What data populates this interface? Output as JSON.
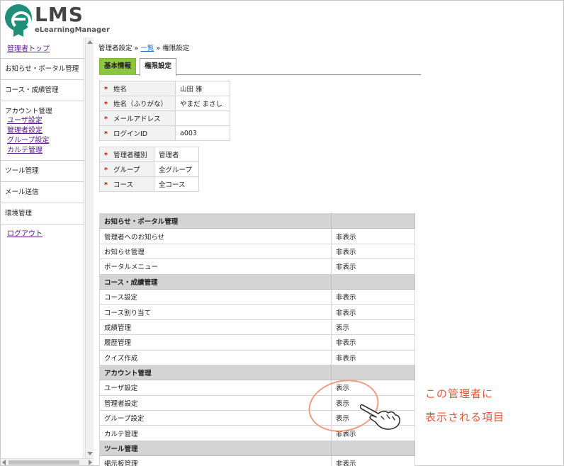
{
  "header": {
    "logo_text": "LMS",
    "logo_subtext": "eLearningManager"
  },
  "sidebar": {
    "admin_top": "管理者トップ",
    "news_portal": "お知らせ・ポータル管理",
    "course_grades": "コース・成績管理",
    "account_title": "アカウント管理",
    "account_links": [
      "ユーザ設定",
      "管理者設定",
      "グループ設定",
      "カルテ管理"
    ],
    "tools": "ツール管理",
    "mail": "メール送信",
    "environment": "環境管理",
    "logout": "ログアウト"
  },
  "breadcrumb": {
    "part1": "管理者設定 » ",
    "link": "一覧",
    "part2": " » 権限設定"
  },
  "tabs": {
    "basic": "基本情報",
    "permission": "権限設定"
  },
  "required_mark": "*",
  "profile": [
    {
      "label": "姓名",
      "value": "山田 雅"
    },
    {
      "label": "姓名（ふりがな）",
      "value": "やまだ まさし"
    },
    {
      "label": "メールアドレス",
      "value": ""
    },
    {
      "label": "ログインID",
      "value": "a003"
    }
  ],
  "roles": [
    {
      "label": "管理者種別",
      "value": "管理者"
    },
    {
      "label": "グループ",
      "value": "全グループ"
    },
    {
      "label": "コース",
      "value": "全コース"
    }
  ],
  "permissions": {
    "groups": [
      {
        "title": "お知らせ・ポータル管理",
        "rows": [
          {
            "name": "管理者へのお知らせ",
            "value": "非表示"
          },
          {
            "name": "お知らせ管理",
            "value": "非表示"
          },
          {
            "name": "ポータルメニュー",
            "value": "非表示"
          }
        ]
      },
      {
        "title": "コース・成績管理",
        "rows": [
          {
            "name": "コース設定",
            "value": "非表示"
          },
          {
            "name": "コース割り当て",
            "value": "非表示"
          },
          {
            "name": "成績管理",
            "value": "表示"
          },
          {
            "name": "履歴管理",
            "value": "非表示"
          },
          {
            "name": "クイズ作成",
            "value": "非表示"
          }
        ]
      },
      {
        "title": "アカウント管理",
        "rows": [
          {
            "name": "ユーザ設定",
            "value": "表示"
          },
          {
            "name": "管理者設定",
            "value": "表示"
          },
          {
            "name": "グループ設定",
            "value": "表示"
          },
          {
            "name": "カルテ管理",
            "value": "非表示"
          }
        ]
      },
      {
        "title": "ツール管理",
        "rows": [
          {
            "name": "掲示板管理",
            "value": "非表示"
          }
        ]
      }
    ]
  },
  "annotation": {
    "line1": "この管理者に",
    "line2": "表示される項目",
    "color": "#e8543a"
  }
}
